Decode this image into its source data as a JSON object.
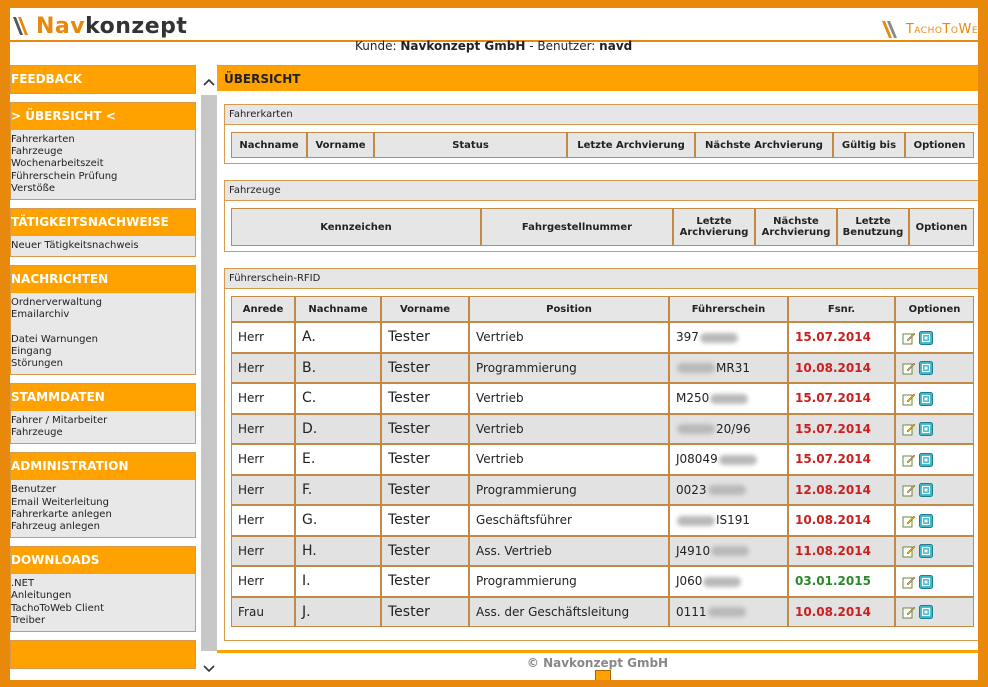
{
  "header": {
    "logo_nav": "Nav",
    "logo_konzept": "konzept",
    "tacho_label": "TachoToWe",
    "kunde_label": "Kunde:",
    "kunde_value": "Navkonzept GmbH",
    "benutzer_label": "- Benutzer:",
    "benutzer_value": "navd"
  },
  "sidebar": {
    "feedback": "FEEDBACK",
    "uebersicht": {
      "title": "> ÜBERSICHT <",
      "items": [
        "Fahrerkarten",
        "Fahrzeuge",
        "Wochenarbeitszeit",
        "Führerschein Prüfung",
        "Verstöße"
      ]
    },
    "taetigkeit": {
      "title": "TÄTIGKEITSNACHWEISE",
      "items": [
        "Neuer Tätigkeitsnachweis"
      ]
    },
    "nachrichten": {
      "title": "NACHRICHTEN",
      "items": [
        "Ordnerverwaltung",
        "Emailarchiv",
        "Datei Warnungen",
        "Eingang",
        "Störungen"
      ]
    },
    "stammdaten": {
      "title": "STAMMDATEN",
      "items": [
        "Fahrer / Mitarbeiter",
        "Fahrzeuge"
      ]
    },
    "administration": {
      "title": "ADMINISTRATION",
      "items": [
        "Benutzer",
        "Email Weiterleitung",
        "Fahrerkarte anlegen",
        "Fahrzeug anlegen"
      ]
    },
    "downloads": {
      "title": "DOWNLOADS",
      "items": [
        ".NET",
        "Anleitungen",
        "TachoToWeb Client",
        "Treiber"
      ]
    }
  },
  "main": {
    "title": "ÜBERSICHT",
    "fahrerkarten": {
      "title": "Fahrerkarten",
      "columns": [
        "Nachname",
        "Vorname",
        "Status",
        "Letzte Archvierung",
        "Nächste Archvierung",
        "Gültig bis",
        "Optionen"
      ]
    },
    "fahrzeuge": {
      "title": "Fahrzeuge",
      "columns": [
        "Kennzeichen",
        "Fahrgestellnummer",
        "Letzte Archvierung",
        "Nächste Archvierung",
        "Letzte Benutzung",
        "Optionen"
      ]
    },
    "rfid": {
      "title": "Führerschein-RFID",
      "columns": [
        "Anrede",
        "Nachname",
        "Vorname",
        "Position",
        "Führerschein",
        "Fsnr.",
        "Optionen"
      ],
      "rows": [
        {
          "anrede": "Herr",
          "nachname": "A.",
          "vorname": "Tester",
          "position": "Vertrieb",
          "fs_pre": "397",
          "fs_post": "",
          "fsnr": "15.07.2014",
          "status": "red"
        },
        {
          "anrede": "Herr",
          "nachname": "B.",
          "vorname": "Tester",
          "position": "Programmierung",
          "fs_pre": "",
          "fs_post": "MR31",
          "fsnr": "10.08.2014",
          "status": "red"
        },
        {
          "anrede": "Herr",
          "nachname": "C.",
          "vorname": "Tester",
          "position": "Vertrieb",
          "fs_pre": "M250",
          "fs_post": "",
          "fsnr": "15.07.2014",
          "status": "red"
        },
        {
          "anrede": "Herr",
          "nachname": "D.",
          "vorname": "Tester",
          "position": "Vertrieb",
          "fs_pre": "",
          "fs_post": "20/96",
          "fsnr": "15.07.2014",
          "status": "red"
        },
        {
          "anrede": "Herr",
          "nachname": "E.",
          "vorname": "Tester",
          "position": "Vertrieb",
          "fs_pre": "J08049",
          "fs_post": "",
          "fsnr": "15.07.2014",
          "status": "red"
        },
        {
          "anrede": "Herr",
          "nachname": "F.",
          "vorname": "Tester",
          "position": "Programmierung",
          "fs_pre": "0023",
          "fs_post": "",
          "fsnr": "12.08.2014",
          "status": "red"
        },
        {
          "anrede": "Herr",
          "nachname": "G.",
          "vorname": "Tester",
          "position": "Geschäftsführer",
          "fs_pre": "",
          "fs_post": "IS191",
          "fsnr": "10.08.2014",
          "status": "red"
        },
        {
          "anrede": "Herr",
          "nachname": "H.",
          "vorname": "Tester",
          "position": "Ass. Vertrieb",
          "fs_pre": "J4910",
          "fs_post": "",
          "fsnr": "11.08.2014",
          "status": "red"
        },
        {
          "anrede": "Herr",
          "nachname": "I.",
          "vorname": "Tester",
          "position": "Programmierung",
          "fs_pre": "J060",
          "fs_post": "",
          "fsnr": "03.01.2015",
          "status": "green"
        },
        {
          "anrede": "Frau",
          "nachname": "J.",
          "vorname": "Tester",
          "position": "Ass. der Geschäftsleitung",
          "fs_pre": "0111",
          "fs_post": "",
          "fsnr": "10.08.2014",
          "status": "red"
        }
      ]
    }
  },
  "footer": {
    "copyright": "© Navkonzept GmbH"
  },
  "colors": {
    "accent": "#ffa200",
    "frame": "#e8890c",
    "expired": "#cc1f1f",
    "valid": "#2a8a2a"
  }
}
